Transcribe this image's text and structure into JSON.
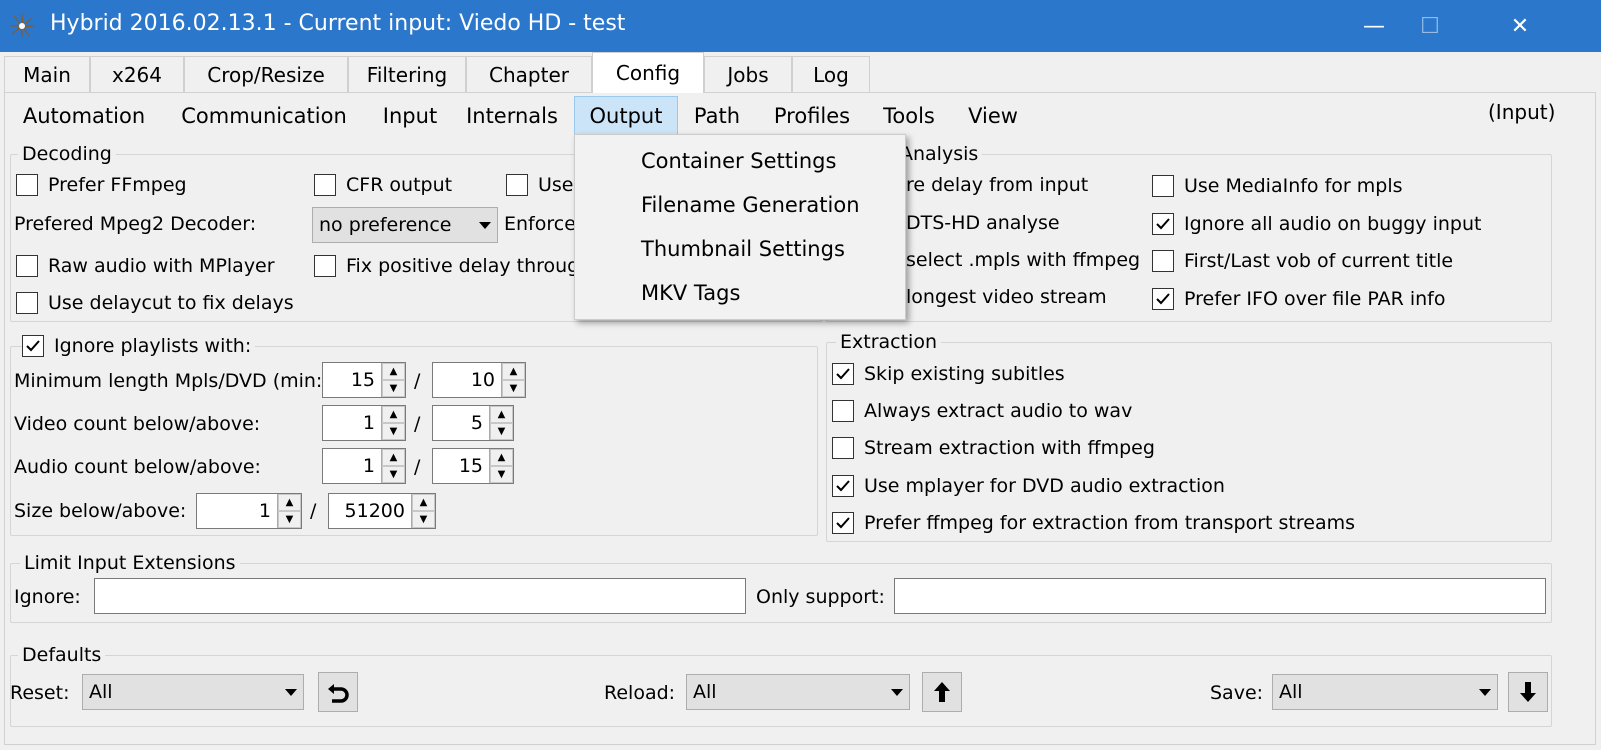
{
  "window": {
    "title": "Hybrid 2016.02.13.1 - Current input: Viedo HD - test",
    "minimize_glyph": "—",
    "maximize_glyph": "☐",
    "close_glyph": "✕"
  },
  "tabs": [
    "Main",
    "x264",
    "Crop/Resize",
    "Filtering",
    "Chapter",
    "Config",
    "Jobs",
    "Log"
  ],
  "active_tab": "Config",
  "menu": [
    "Automation",
    "Communication",
    "Input",
    "Internals",
    "Output",
    "Path",
    "Profiles",
    "Tools",
    "View"
  ],
  "menu_open": "Output",
  "input_hint": "(Input)",
  "dropdown": [
    "Container Settings",
    "Filename Generation",
    "Thumbnail Settings",
    "MKV Tags"
  ],
  "decoding": {
    "title": "Decoding",
    "prefer_ffmpeg": {
      "label": "Prefer FFmpeg",
      "checked": false
    },
    "cfr_output": {
      "label": "CFR output",
      "checked": false
    },
    "use_partial": {
      "label": "Use",
      "checked": false
    },
    "mpeg2_label": "Prefered Mpeg2 Decoder:",
    "mpeg2_value": "no preference",
    "enforce_partial": "Enforce",
    "raw_audio": {
      "label": "Raw audio with MPlayer",
      "checked": false
    },
    "fix_positive": {
      "label": "Fix positive delay throug",
      "checked": false
    },
    "delaycut": {
      "label": "Use delaycut to fix delays",
      "checked": false
    }
  },
  "analysis": {
    "title": "Analysis",
    "left": [
      {
        "label": "re delay from input"
      },
      {
        "label": "DTS-HD analyse"
      },
      {
        "label": "select .mpls with ffmpeg"
      },
      {
        "label": "longest video stream"
      }
    ],
    "right": [
      {
        "label": "Use MediaInfo for mpls",
        "checked": false
      },
      {
        "label": "Ignore all audio on buggy input",
        "checked": true
      },
      {
        "label": "First/Last vob of current title",
        "checked": false
      },
      {
        "label": "Prefer IFO over file PAR info",
        "checked": true
      }
    ]
  },
  "playlists": {
    "ignore": {
      "label": "Ignore playlists with:",
      "checked": true
    },
    "min_length": {
      "label": "Minimum length Mpls/DVD (min:)",
      "a": "15",
      "b": "10"
    },
    "video_count": {
      "label": "Video count below/above:",
      "a": "1",
      "b": "5"
    },
    "audio_count": {
      "label": "Audio count below/above:",
      "a": "1",
      "b": "15"
    },
    "size": {
      "label": "Size below/above:",
      "a": "1",
      "b": "51200"
    },
    "slash": "/"
  },
  "extraction": {
    "title": "Extraction",
    "items": [
      {
        "label": "Skip existing subitles",
        "checked": true
      },
      {
        "label": "Always extract audio to wav",
        "checked": false
      },
      {
        "label": "Stream extraction with ffmpeg",
        "checked": false
      },
      {
        "label": "Use mplayer for DVD audio extraction",
        "checked": true
      },
      {
        "label": "Prefer ffmpeg for extraction from transport streams",
        "checked": true
      }
    ]
  },
  "limit_ext": {
    "title": "Limit Input Extensions",
    "ignore_label": "Ignore:",
    "ignore_value": "",
    "only_label": "Only support:",
    "only_value": ""
  },
  "defaults": {
    "title": "Defaults",
    "reset_label": "Reset:",
    "reset_value": "All",
    "reload_label": "Reload:",
    "reload_value": "All",
    "save_label": "Save:",
    "save_value": "All"
  }
}
